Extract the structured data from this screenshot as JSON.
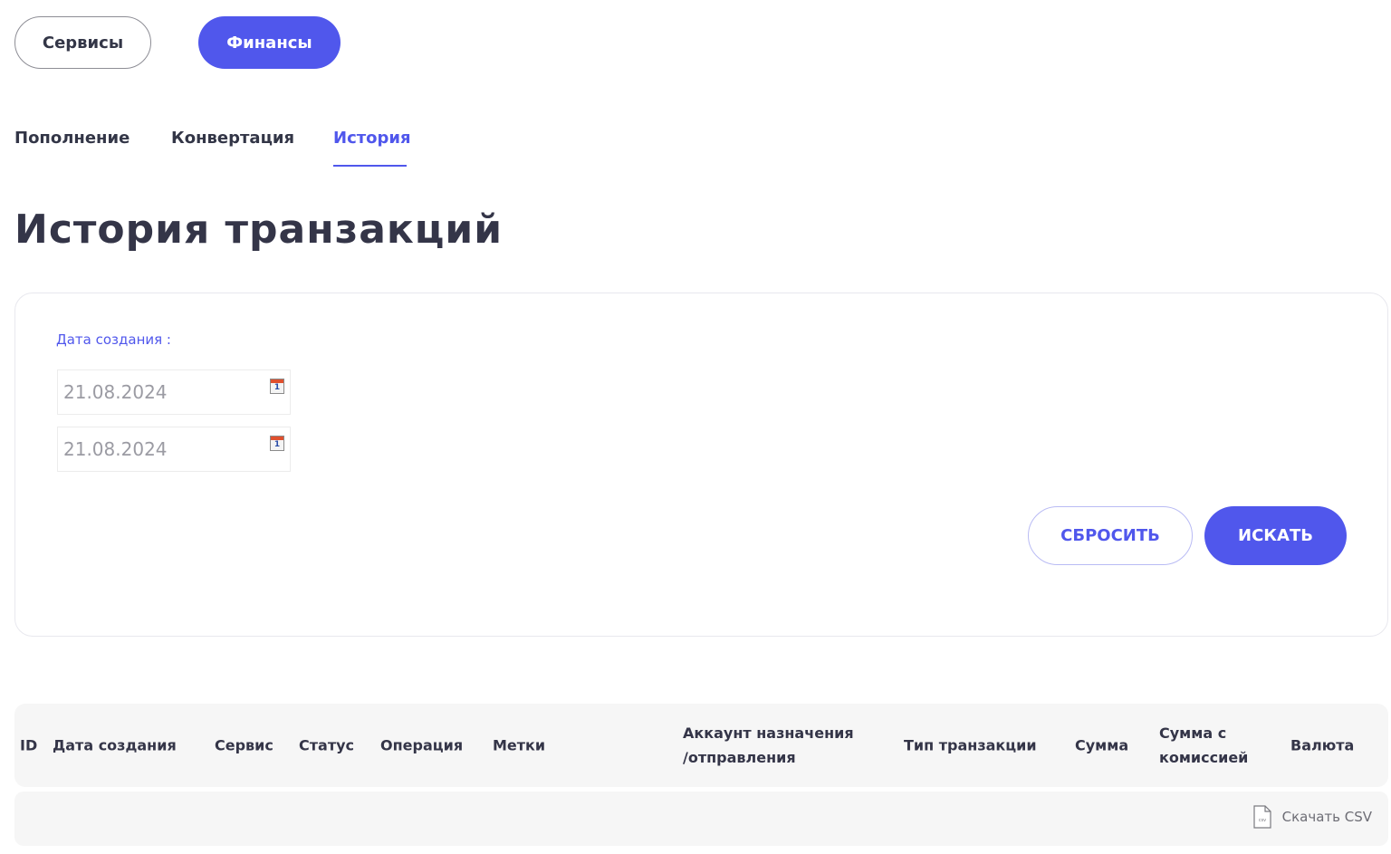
{
  "top_tabs": {
    "services": "Сервисы",
    "finance": "Финансы"
  },
  "sub_tabs": {
    "topup": "Пополнение",
    "convert": "Конвертация",
    "history": "История"
  },
  "page_title": "История транзакций",
  "filter": {
    "label": "Дата создания :",
    "date_from": "21.08.2024",
    "date_to": "21.08.2024",
    "calendar_day": "1",
    "reset_label": "СБРОСИТЬ",
    "search_label": "ИСКАТЬ"
  },
  "table": {
    "columns": [
      "ID",
      "Дата создания",
      "Сервис",
      "Статус",
      "Операция",
      "Метки",
      "Аккаунт назначения\n/отправления",
      "Тип транзакции",
      "Сумма",
      "Сумма с\nкомиссией",
      "Валюта"
    ]
  },
  "csv": {
    "label": "Скачать CSV",
    "icon_text": "csv"
  },
  "colors": {
    "accent": "#5057ec",
    "text": "#343548",
    "muted": "#9b9ba3"
  }
}
